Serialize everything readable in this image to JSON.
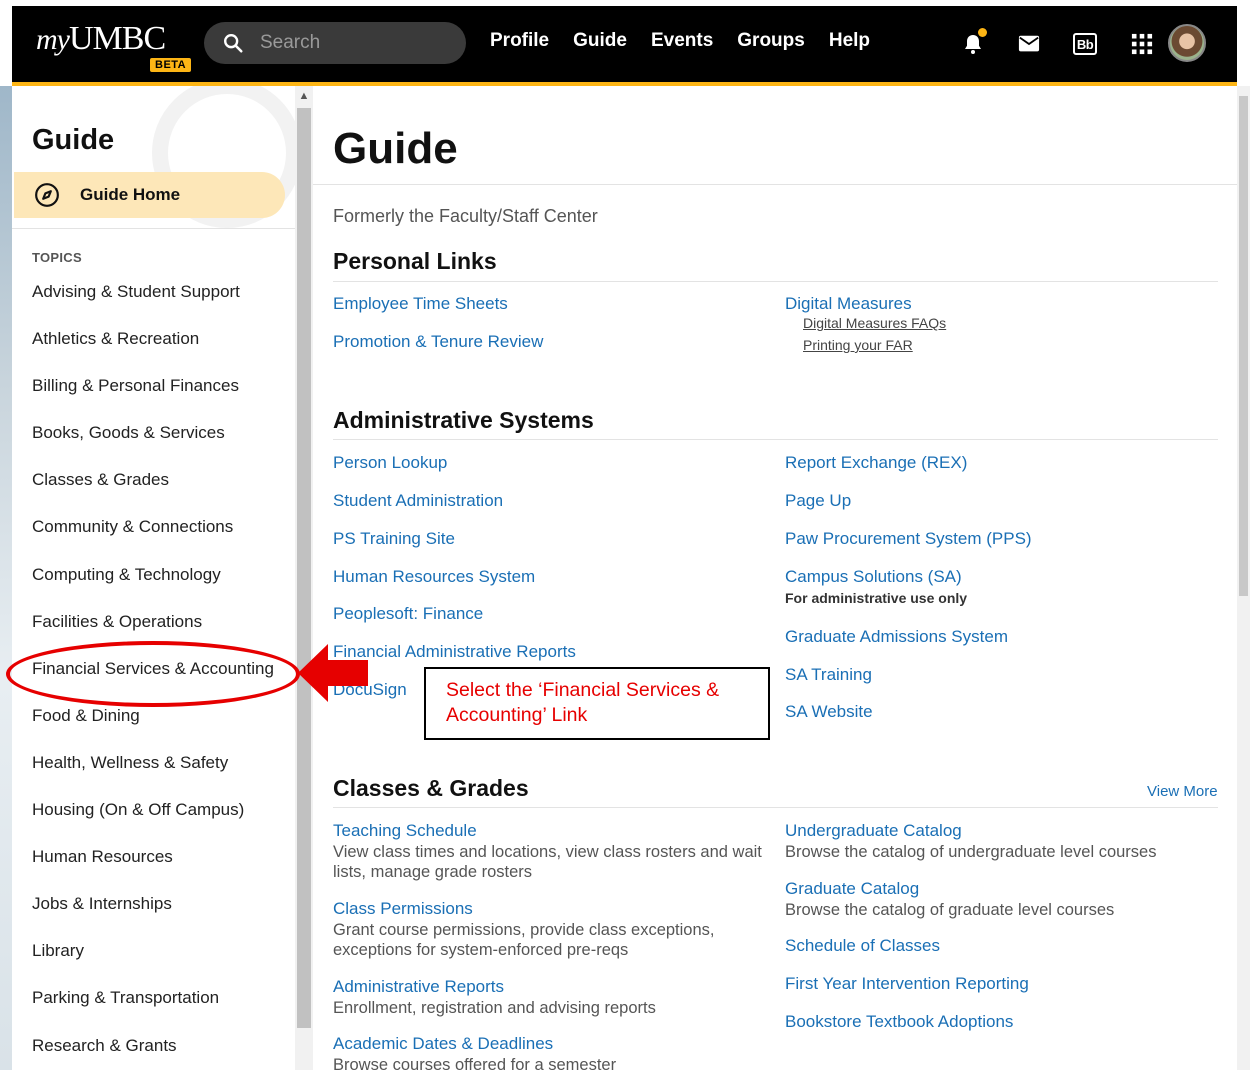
{
  "header": {
    "logo_text": "myUMBC",
    "beta_badge": "BETA",
    "search_placeholder": "Search",
    "nav": [
      "Profile",
      "Guide",
      "Events",
      "Groups",
      "Help"
    ],
    "icons": [
      "bell-icon",
      "mail-icon",
      "blackboard-icon",
      "apps-grid-icon",
      "avatar"
    ],
    "blackboard_label": "Bb"
  },
  "colors": {
    "accent_gold": "#fdb515",
    "link_blue": "#1a6fb5",
    "highlight_bg": "#fde7b8",
    "annotation_red": "#e60000"
  },
  "sidebar": {
    "title": "Guide",
    "home_label": "Guide Home",
    "topics_label": "TOPICS",
    "items": [
      "Advising & Student Support",
      "Athletics & Recreation",
      "Billing & Personal Finances",
      "Books, Goods & Services",
      "Classes & Grades",
      "Community & Connections",
      "Computing & Technology",
      "Facilities & Operations",
      "Financial Services & Accounting",
      "Food & Dining",
      "Health, Wellness & Safety",
      "Housing (On & Off Campus)",
      "Human Resources",
      "Jobs & Internships",
      "Library",
      "Parking & Transportation",
      "Research & Grants"
    ]
  },
  "main": {
    "title": "Guide",
    "subtitle": "Formerly the Faculty/Staff Center",
    "personal_links": {
      "title": "Personal Links",
      "left": [
        "Employee Time Sheets",
        "Promotion & Tenure Review"
      ],
      "right_main": "Digital Measures",
      "right_subs": [
        "Digital Measures FAQs",
        "Printing your FAR"
      ]
    },
    "admin_systems": {
      "title": "Administrative Systems",
      "left": [
        "Person Lookup",
        "Student Administration",
        "PS Training Site",
        "Human Resources System",
        "Peoplesoft: Finance",
        "Financial Administrative Reports",
        "DocuSign"
      ],
      "right": [
        "Report Exchange (REX)",
        "Page Up",
        "Paw Procurement System (PPS)",
        "Campus Solutions (SA)",
        "Graduate Admissions System",
        "SA Training",
        "SA Website"
      ],
      "campus_note": "For administrative use only"
    },
    "classes": {
      "title": "Classes & Grades",
      "view_more": "View More",
      "left": [
        {
          "title": "Teaching Schedule",
          "desc": "View class times and locations, view class rosters and wait lists, manage grade rosters"
        },
        {
          "title": "Class Permissions",
          "desc": "Grant course permissions, provide class exceptions, exceptions for system-enforced pre-reqs"
        },
        {
          "title": "Administrative Reports",
          "desc": "Enrollment, registration and advising reports"
        },
        {
          "title": "Academic Dates & Deadlines",
          "desc": "Browse courses offered for a semester"
        }
      ],
      "right": [
        {
          "title": "Undergraduate Catalog",
          "desc": "Browse the catalog of undergraduate level courses"
        },
        {
          "title": "Graduate Catalog",
          "desc": "Browse the catalog of graduate level courses"
        },
        {
          "title": "Schedule of Classes",
          "desc": ""
        },
        {
          "title": "First Year Intervention Reporting",
          "desc": ""
        },
        {
          "title": "Bookstore Textbook Adoptions",
          "desc": ""
        }
      ]
    }
  },
  "annotation": {
    "callout": "Select the ‘Financial Services & Accounting’ Link"
  }
}
